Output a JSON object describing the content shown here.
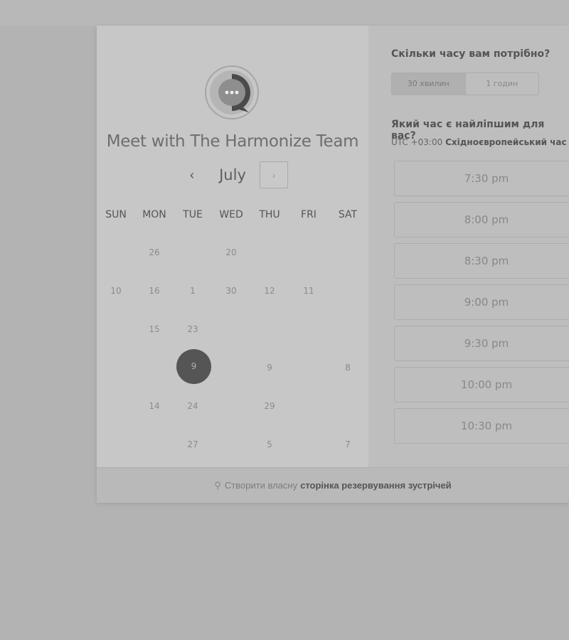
{
  "calendar": {
    "title": "Meet with The Harmonize Team",
    "month": "July",
    "prev_icon": "‹",
    "next_icon": "›",
    "weekdays": [
      "SUN",
      "MON",
      "TUE",
      "WED",
      "THU",
      "FRI",
      "SAT"
    ],
    "rows": [
      [
        "",
        "26",
        "",
        "20",
        "",
        "",
        ""
      ],
      [
        "10",
        "16",
        "1",
        "30",
        "12",
        "11",
        ""
      ],
      [
        "",
        "15",
        "23",
        "",
        "",
        "",
        ""
      ],
      [
        "",
        "",
        "9",
        "",
        "9",
        "",
        "8"
      ],
      [
        "",
        "14",
        "24",
        "",
        "29",
        "",
        ""
      ],
      [
        "",
        "",
        "27",
        "",
        "5",
        "",
        "7"
      ]
    ],
    "selected_day": "9"
  },
  "booking": {
    "duration_question": "Скільки часу вам потрібно?",
    "durations": [
      "30 хвилин",
      "1 годин"
    ],
    "time_question": "Який час є найліпшим для вас?",
    "timezone_prefix": "UTC +03:00",
    "timezone_name": "Східноєвропейський час",
    "slots": [
      "7:30 pm",
      "8:00 pm",
      "8:30 pm",
      "9:00 pm",
      "9:30 pm",
      "10:00 pm",
      "10:30 pm"
    ]
  },
  "footer": {
    "prefix": "Створити власну",
    "link": "сторінка резервування зустрічей"
  },
  "colors": {
    "background": "#b3b3b3",
    "panel": "#c7c7c7",
    "selected": "#555555"
  }
}
